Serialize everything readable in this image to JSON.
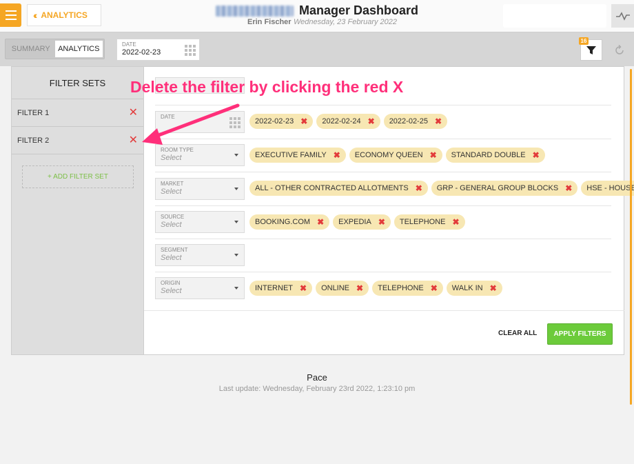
{
  "header": {
    "back_label": "ANALYTICS",
    "title": "Manager Dashboard",
    "user_name": "Erin Fischer",
    "date_now": "Wednesday, 23 February 2022"
  },
  "toolbar": {
    "tabs": [
      {
        "label": "SUMMARY",
        "active": false
      },
      {
        "label": "ANALYTICS",
        "active": true
      }
    ],
    "date_label": "DATE",
    "date_value": "2022-02-23",
    "filter_badge": "16"
  },
  "filter_sets": {
    "title": "FILTER SETS",
    "items": [
      {
        "label": "FILTER 1"
      },
      {
        "label": "FILTER 2"
      }
    ],
    "add_label": "+ ADD FILTER SET"
  },
  "filters": {
    "date": {
      "label": "DATE",
      "chips": [
        "2022-02-23",
        "2022-02-24",
        "2022-02-25"
      ]
    },
    "room_type": {
      "label": "ROOM TYPE",
      "placeholder": "Select",
      "chips": [
        "EXECUTIVE FAMILY",
        "ECONOMY QUEEN",
        "STANDARD DOUBLE"
      ]
    },
    "market": {
      "label": "MARKET",
      "placeholder": "Select",
      "chips": [
        "ALL - OTHER CONTRACTED ALLOTMENTS",
        "GRP - GENERAL GROUP BLOCKS",
        "HSE - HOUSE"
      ]
    },
    "source": {
      "label": "SOURCE",
      "placeholder": "Select",
      "chips": [
        "BOOKING.COM",
        "EXPEDIA",
        "TELEPHONE"
      ]
    },
    "segment": {
      "label": "SEGMENT",
      "placeholder": "Select",
      "chips": []
    },
    "origin": {
      "label": "ORIGIN",
      "placeholder": "Select",
      "chips": [
        "INTERNET",
        "ONLINE",
        "TELEPHONE",
        "WALK IN"
      ]
    },
    "clear_all": "CLEAR ALL",
    "apply": "APPLY FILTERS"
  },
  "annotation": {
    "text": "Delete the filter by clicking the red X",
    "color": "#ff2f7a"
  },
  "footer": {
    "section": "Pace",
    "last_update": "Last update: Wednesday, February 23rd 2022, 1:23:10 pm"
  },
  "colors": {
    "accent": "#f5a623",
    "chip_bg": "#f7e7b3",
    "remove_x": "#e23b3b",
    "apply_green": "#6ccb3b"
  }
}
